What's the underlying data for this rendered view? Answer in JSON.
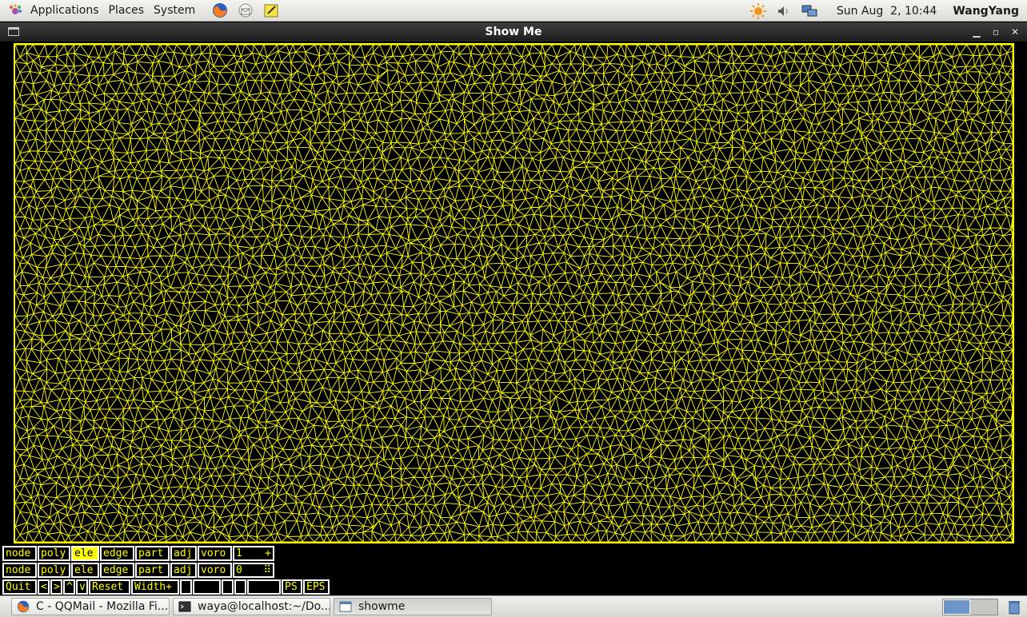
{
  "top_panel": {
    "menus": [
      "Applications",
      "Places",
      "System"
    ],
    "launchers": [
      "firefox-icon",
      "mail-icon",
      "notes-icon"
    ],
    "tray": [
      "weather-sun-icon",
      "volume-icon",
      "network-icon"
    ],
    "clock": "Sun Aug  2, 10:44",
    "user": "WangYang"
  },
  "window": {
    "title": "Show Me",
    "buttons": [
      "minimize",
      "maximize",
      "close"
    ]
  },
  "mesh": {
    "line_color": "#ffff00",
    "background": "#000000",
    "element_type": "triangulation"
  },
  "controls": {
    "row1": [
      "node",
      "poly",
      "ele",
      "edge",
      "part",
      "adj",
      "voro",
      "1",
      "+"
    ],
    "row1_active": "ele",
    "row2": [
      "node",
      "poly",
      "ele",
      "edge",
      "part",
      "adj",
      "voro",
      "0",
      "⠿"
    ],
    "row3": [
      "Quit",
      "<",
      ">",
      "^",
      "v",
      "Reset",
      "Width+",
      "",
      "",
      "",
      "",
      "",
      "PS",
      "EPS"
    ]
  },
  "taskbar": {
    "tasks": [
      {
        "label": "C - QQMail - Mozilla Fi...",
        "icon": "firefox-icon"
      },
      {
        "label": "waya@localhost:~/Do...",
        "icon": "terminal-icon"
      },
      {
        "label": "showme",
        "icon": "window-icon"
      }
    ],
    "active_task": "showme"
  }
}
